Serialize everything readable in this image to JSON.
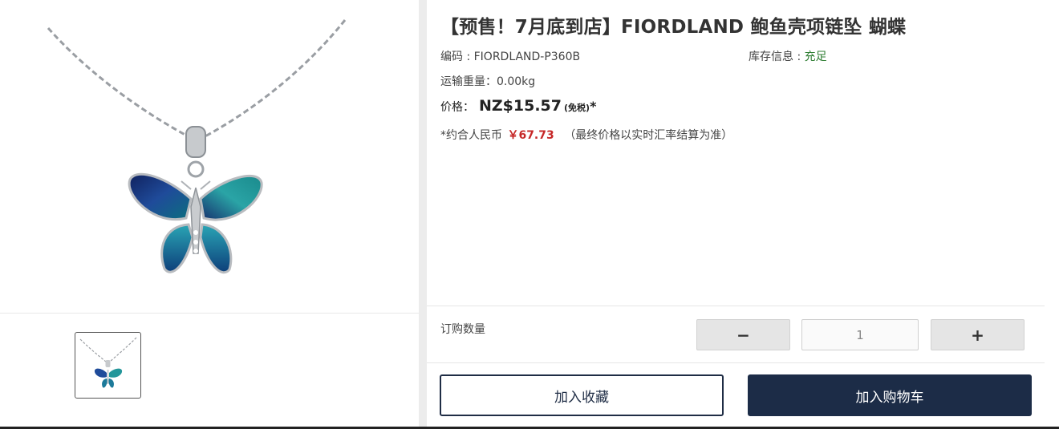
{
  "product": {
    "title": "【预售！7月底到店】FIORDLAND 鲍鱼壳项链坠 蝴蝶",
    "sku_label": "编码 : ",
    "sku_value": "FIORDLAND-P360B",
    "stock_label": "库存信息 : ",
    "stock_value": "充足",
    "weight_label": "运输重量：",
    "weight_value": "0.00kg",
    "price_label": "价格：",
    "price_value": "NZ$15.57",
    "price_tax": "(免税)",
    "price_star": "*",
    "rmb_prefix": "*约合人民币",
    "rmb_value": "￥67.73",
    "rmb_note": "（最终价格以实时汇率结算为准）"
  },
  "quantity": {
    "label": "订购数量",
    "minus": "−",
    "value": "1",
    "plus": "+"
  },
  "actions": {
    "favorite_label": "加入收藏",
    "cart_label": "加入购物车"
  },
  "gallery": {
    "main_image_icon": "butterfly-pendant-image",
    "thumbnail_icon": "butterfly-pendant-thumbnail"
  },
  "colors": {
    "primary_navy": "#1c2c47",
    "stock_green": "#2e7d32",
    "rmb_red": "#c62828"
  }
}
